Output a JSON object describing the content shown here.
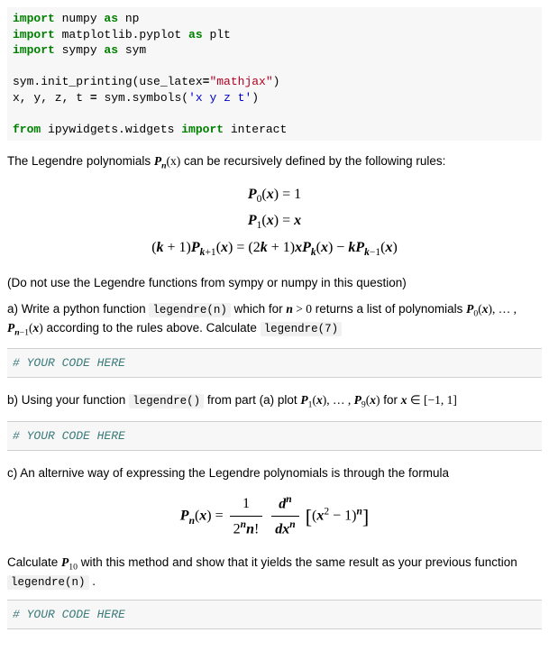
{
  "code": {
    "import_kw": "import",
    "as_kw": "as",
    "from_kw": "from",
    "line1_mod": " numpy ",
    "line1_alias": " np",
    "line2_mod": " matplotlib.pyplot ",
    "line2_alias": " plt",
    "line3_mod": " sympy ",
    "line3_alias": " sym",
    "line4_a": "sym.init_printing(use_latex",
    "line4_eq": "=",
    "line4_str": "\"mathjax\"",
    "line4_b": ")",
    "line5_a": "x, y, z, t ",
    "line5_eq": "=",
    "line5_b": " sym.symbols(",
    "line5_str": "'x y z t'",
    "line5_c": ")",
    "line6_mod": " ipywidgets.widgets ",
    "line6_import": " interact"
  },
  "intro": {
    "text_a": "The Legendre polynomials ",
    "math_Pn": "P",
    "math_sub_n": "n",
    "math_x": "(x)",
    "text_b": " can be recursively defined by the following rules:"
  },
  "recursion": {
    "eq1": "P₀(x) = 1",
    "eq2": "P₁(x) = x",
    "eq3": "(k + 1)Pₖ₊₁(x) = (2k + 1)xPₖ(x) − kPₖ₋₁(x)"
  },
  "note": "(Do not use the Legendre functions from sympy or numpy in this question)",
  "part_a": {
    "label": "a) Write a python function ",
    "code1": "legendre(n)",
    "mid1": " which for ",
    "math_cond": "n > 0",
    "mid2": " returns a list of polynomials ",
    "math_list": "P₀(x), … , Pₙ₋₁(x)",
    "mid3": " according to the rules above. Calculate ",
    "code2": "legendre(7)"
  },
  "placeholder": "# YOUR CODE HERE",
  "part_b": {
    "label": "b) Using your function ",
    "code1": "legendre()",
    "mid1": " from part (a) plot ",
    "math_list": "P₁(x), … , P₉(x)",
    "mid2": " for ",
    "math_range": "x ∈ [−1, 1]"
  },
  "part_c": {
    "label": "c) An alternive way of expressing the Legendre polynomials is through the formula",
    "formula_lhs": "Pₙ(x) = ",
    "frac1_num": "1",
    "frac1_den": "2ⁿn!",
    "frac2_num": "dⁿ",
    "frac2_den": "dxⁿ",
    "bracket_inner": "(x² − 1)ⁿ",
    "after": "Calculate ",
    "math_p10": "P₁₀",
    "after2": " with this method and show that it yields the same result as your previous function ",
    "code1": "legendre(n)",
    "after3": " ."
  }
}
